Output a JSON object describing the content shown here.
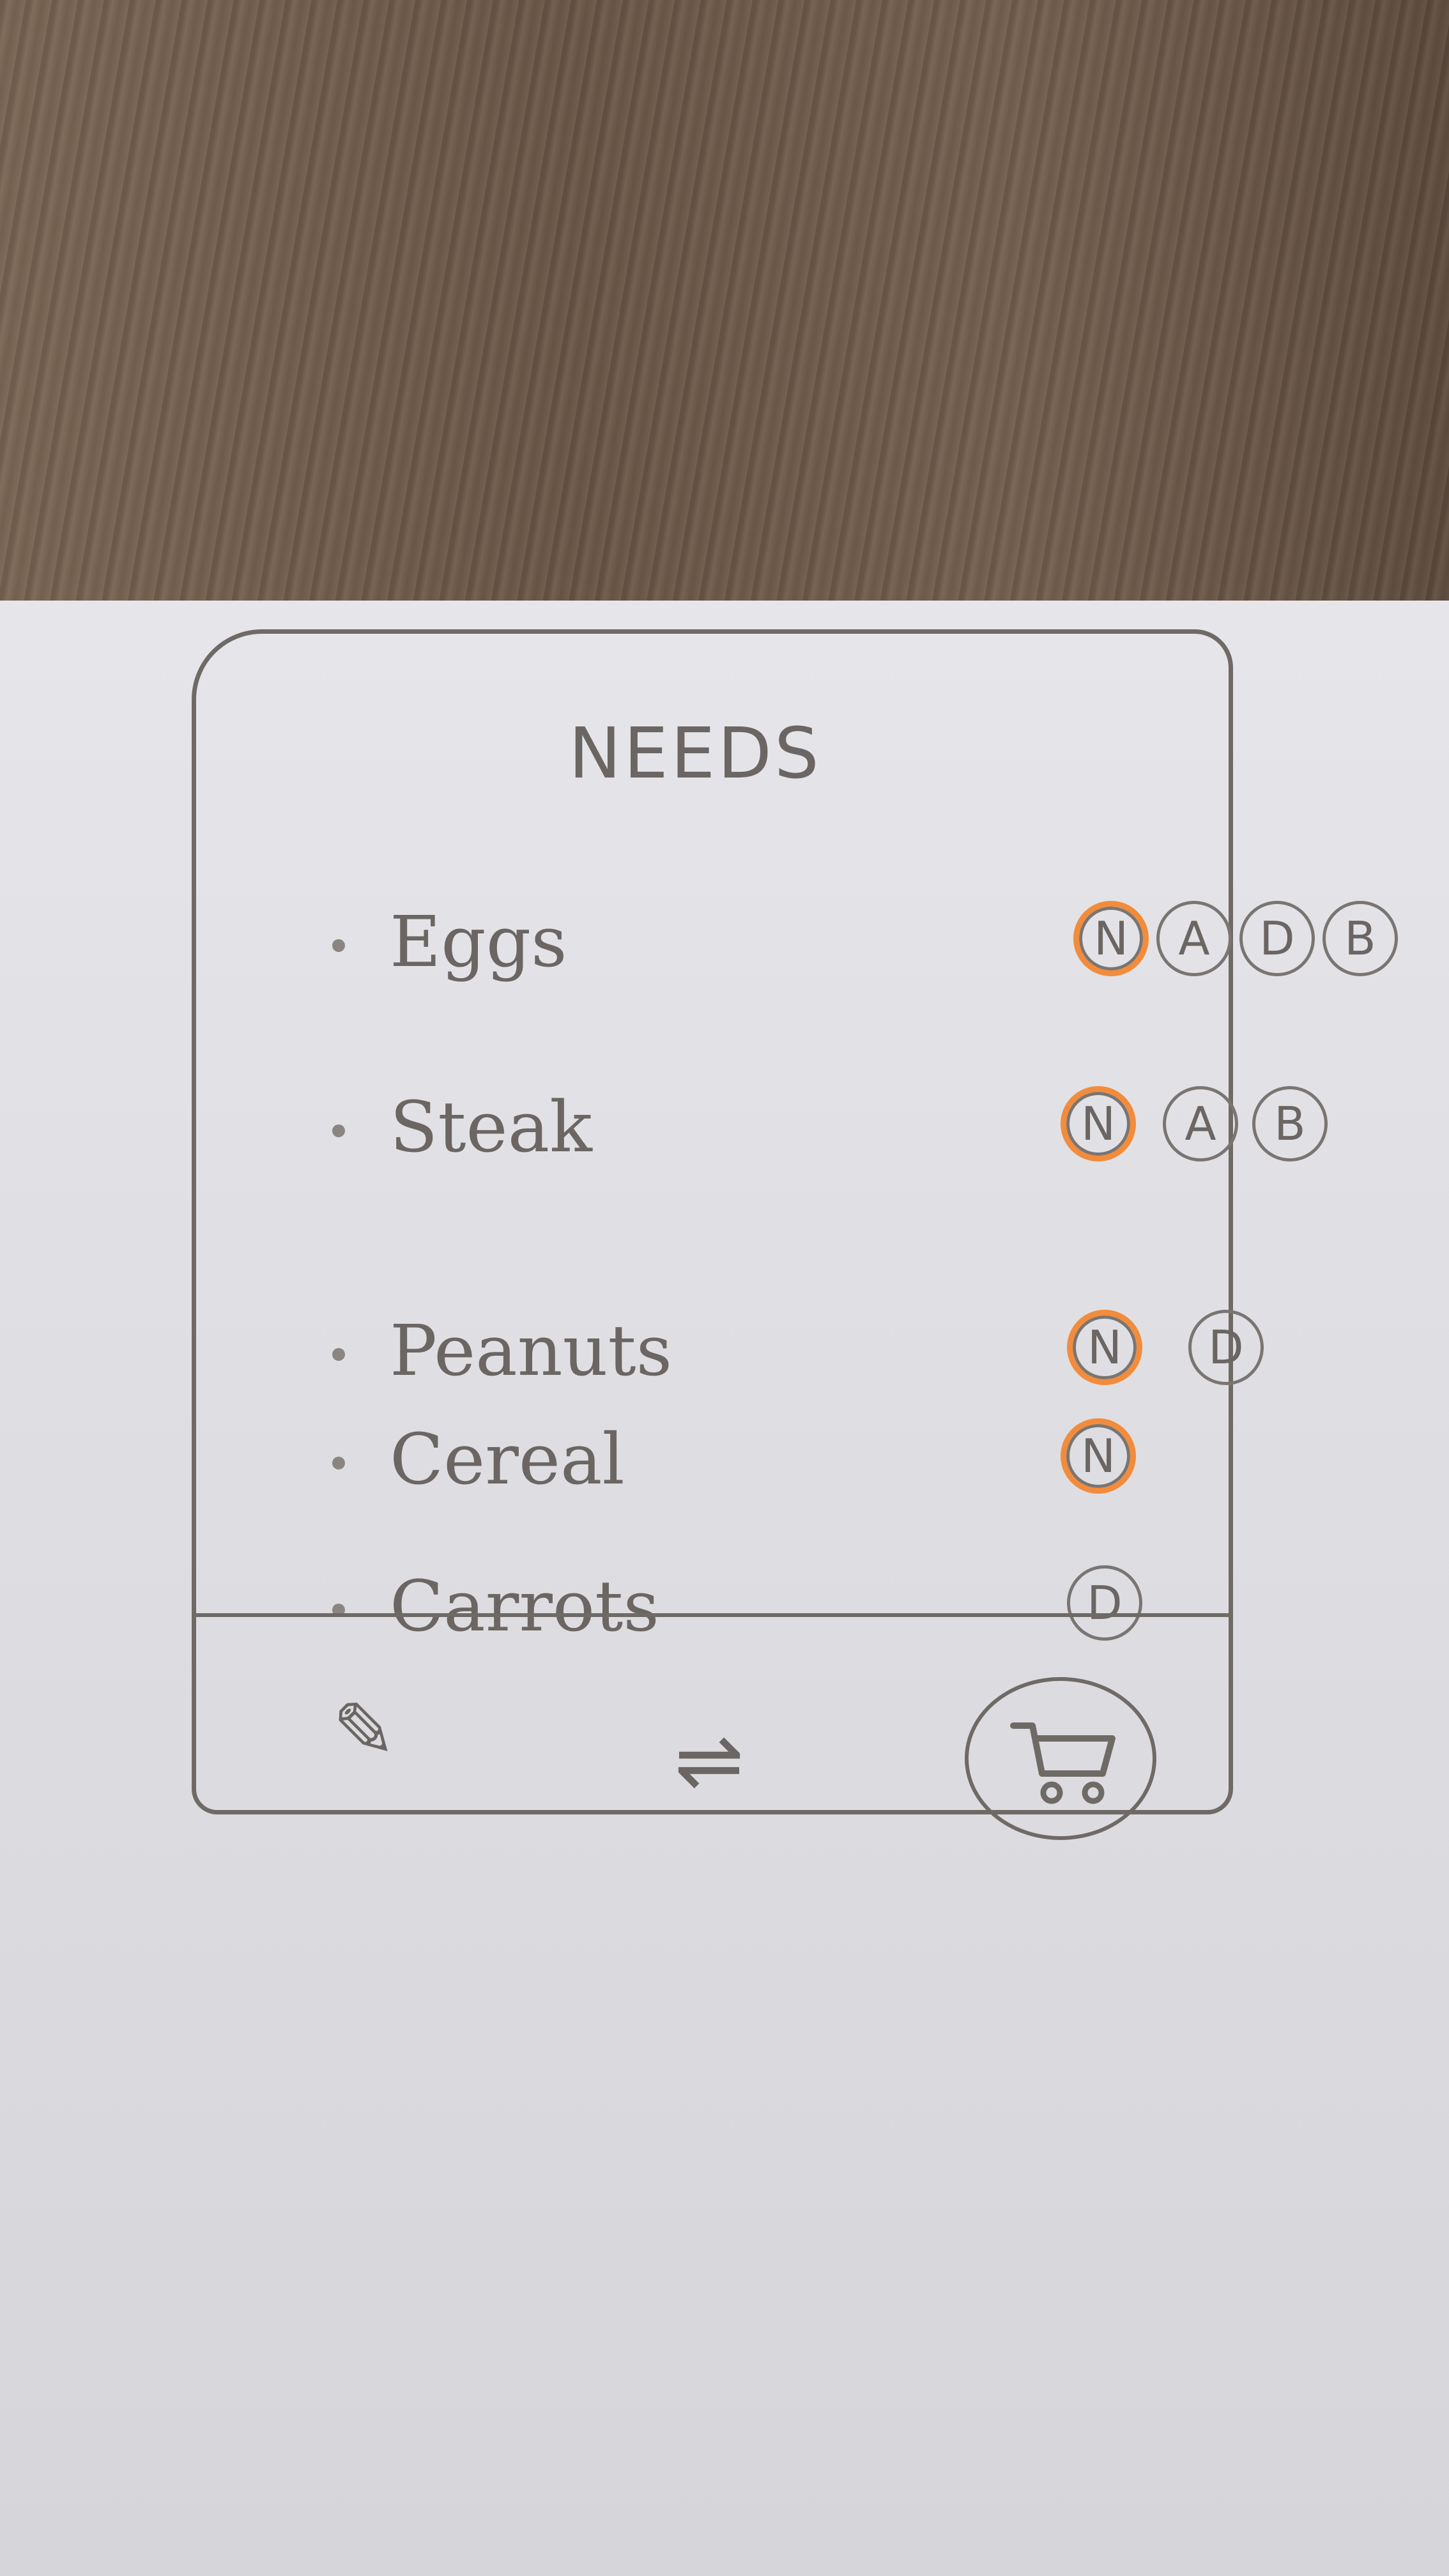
{
  "screen": {
    "title": "NEEDS"
  },
  "items": [
    {
      "name": "Eggs",
      "tags": [
        {
          "label": "N",
          "active": true
        },
        {
          "label": "A",
          "active": false
        },
        {
          "label": "D",
          "active": false
        },
        {
          "label": "B",
          "active": false
        }
      ]
    },
    {
      "name": "Steak",
      "tags": [
        {
          "label": "N",
          "active": true
        },
        {
          "label": "A",
          "active": false
        },
        {
          "label": "B",
          "active": false
        }
      ]
    },
    {
      "name": "Peanuts",
      "tags": [
        {
          "label": "N",
          "active": true
        },
        {
          "label": "D",
          "active": false
        }
      ]
    },
    {
      "name": "Cereal",
      "tags": [
        {
          "label": "N",
          "active": true
        }
      ]
    },
    {
      "name": "Carrots",
      "tags": [
        {
          "label": "D",
          "active": false
        }
      ]
    }
  ],
  "bottom_nav": {
    "edit_icon": "pencil-icon",
    "swap_icon": "swap-arrows-icon",
    "cart_icon": "shopping-cart-icon"
  },
  "colors": {
    "active_ring": "#f28c3c",
    "pencil": "#6f6a66",
    "paper": "#e2e2e6",
    "table": "#6b5747"
  }
}
